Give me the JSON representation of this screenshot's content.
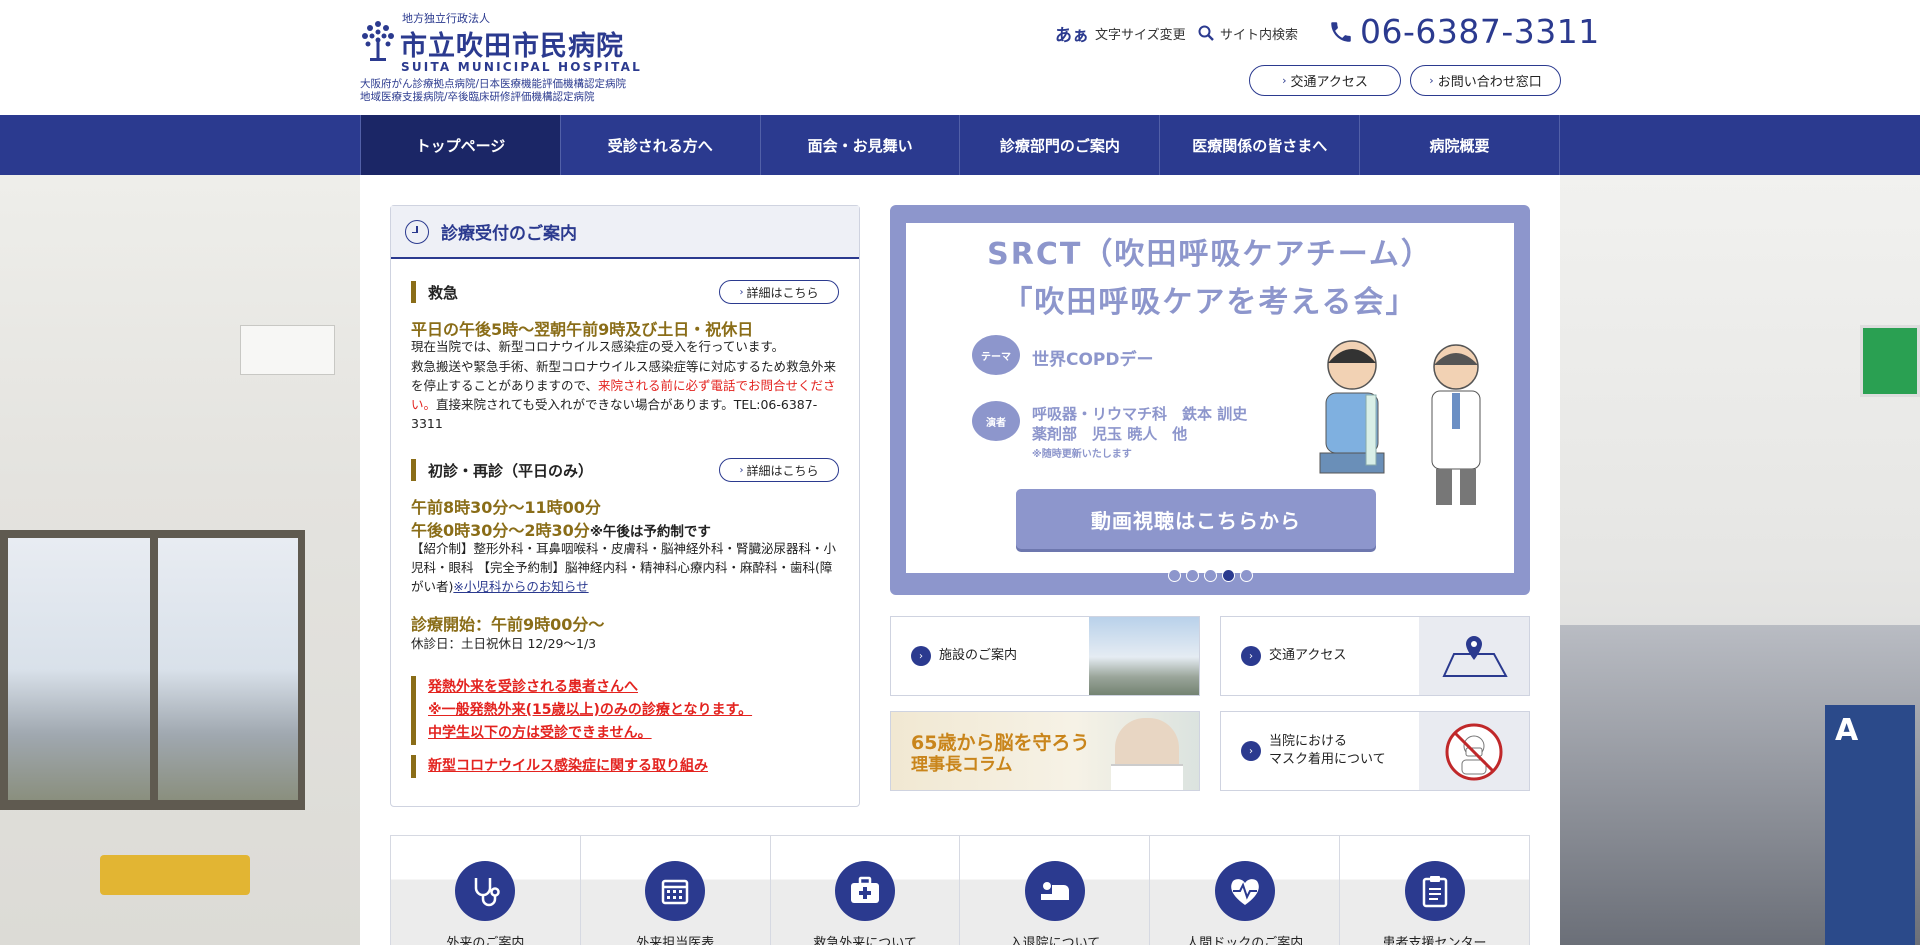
{
  "header": {
    "org_type": "地方独立行政法人",
    "hospital_name": "市立吹田市民病院",
    "hospital_name_en": "SUITA MUNICIPAL HOSPITAL",
    "cert_line1": "大阪府がん診療拠点病院/日本医療機能評価機構認定病院",
    "cert_line2": "地域医療支援病院/卒後臨床研修評価機構認定病院",
    "font_size_icon": "あぁ",
    "font_size_label": "文字サイズ変更",
    "search_label": "サイト内検索",
    "phone": "06-6387-3311",
    "access_btn": "交通アクセス",
    "contact_btn": "お問い合わせ窓口"
  },
  "nav": [
    {
      "label": "トップページ",
      "active": true
    },
    {
      "label": "受診される方へ"
    },
    {
      "label": "面会・お見舞い"
    },
    {
      "label": "診療部門のご案内"
    },
    {
      "label": "医療関係の皆さまへ"
    },
    {
      "label": "病院概要"
    }
  ],
  "info": {
    "title": "診療受付のご案内",
    "detail_label": "詳細はこちら",
    "emergency": {
      "heading": "救急",
      "hours": "平日の午後5時〜翌朝午前9時及び土日・祝休日",
      "covid_notice": "現在当院では、新型コロナウイルス感染症の受入を行っています。",
      "body1": "救急搬送や緊急手術、新型コロナウイルス感染症等に対応するため救急外来を停止することがありますので、",
      "body_red": "来院される前に必ず電話でお問合せください。",
      "body2": "直接来院されても受入れができない場合があります。TEL:06-6387-3311"
    },
    "outpatient": {
      "heading": "初診・再診（平日のみ）",
      "am": "午前8時30分〜11時00分",
      "pm": "午後0時30分〜2時30分",
      "pm_note": "※午後は予約制です",
      "depts": "【紹介制】整形外科・耳鼻咽喉科・皮膚科・脳神経外科・腎臓泌尿器科・小児科・眼科 【完全予約制】脳神経内科・精神科心療内科・麻酔科・歯科(障がい者)",
      "pediatric_link": "※小児科からのお知らせ",
      "start": "診療開始：午前9時00分〜",
      "closed": "休診日：土日祝休日 12/29〜1/3"
    },
    "fever_alert": [
      "発熱外来を受診される患者さんへ",
      "※一般発熱外来(15歳以上)のみの診療となります。",
      "中学生以下の方は受診できません。"
    ],
    "covid_link": "新型コロナウイルス感染症に関する取り組み"
  },
  "slider": {
    "title1": "SRCT（吹田呼吸ケアチーム）",
    "title2": "「吹田呼吸ケアを考える会」",
    "theme_badge": "テーマ",
    "theme": "世界COPDデー",
    "speaker_badge": "演者",
    "speaker1": "呼吸器・リウマチ科　鉄本 訓史",
    "speaker2": "薬剤部　児玉 暁人　他",
    "speaker_note": "※随時更新いたします",
    "video_btn": "動画視聴はこちらから",
    "slide_count": 5,
    "active_slide": 4
  },
  "tiles": {
    "facility": "施設のご案内",
    "access": "交通アクセス",
    "column_line1": "65歳から脳を守ろう",
    "column_line2": "理事長コラム",
    "mask_line1": "当院における",
    "mask_line2": "マスク着用について"
  },
  "bottom_icons": [
    {
      "label": "外来のご案内",
      "icon": "stethoscope-icon"
    },
    {
      "label": "外来担当医表",
      "icon": "calendar-icon"
    },
    {
      "label": "救急外来について",
      "icon": "first-aid-kit-icon"
    },
    {
      "label": "入退院について",
      "icon": "bed-icon"
    },
    {
      "label": "人間ドックのご案内",
      "icon": "heart-pulse-icon"
    },
    {
      "label": "患者支援センター",
      "icon": "clipboard-icon"
    }
  ],
  "colors": {
    "brand": "#2b3a8f",
    "gold": "#8a6d18",
    "alert": "#e3231f",
    "slide": "#8d96cc"
  }
}
